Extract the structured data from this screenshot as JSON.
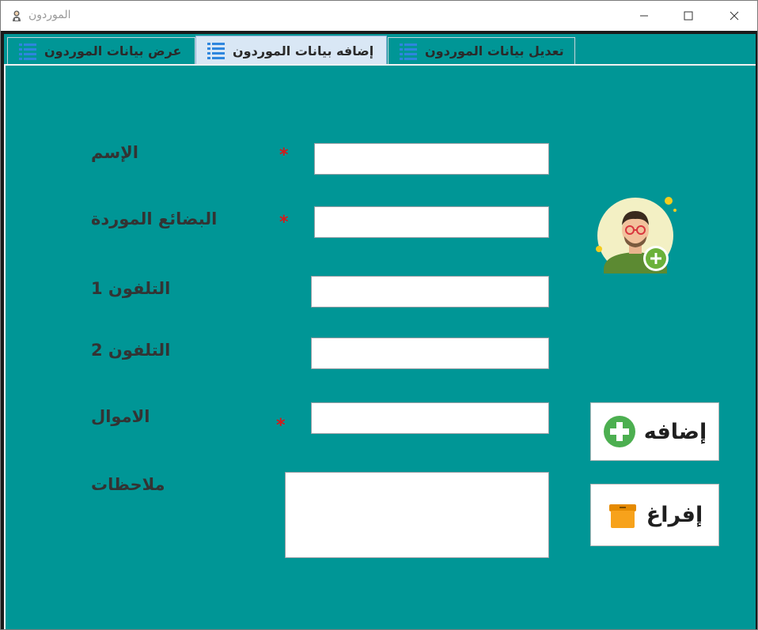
{
  "window": {
    "title": "الموردون",
    "app_icon": "person-icon"
  },
  "tabs": [
    {
      "label": "عرض بيانات الموردون",
      "icon": "list-icon",
      "active": false
    },
    {
      "label": "إضافه بيانات الموردون",
      "icon": "list-icon",
      "active": true
    },
    {
      "label": "تعديل بيانات الموردون",
      "icon": "list-icon",
      "active": false
    }
  ],
  "form": {
    "name_label": "الإسم",
    "goods_label": "البضائع الموردة",
    "phone1_label": "التلفون 1",
    "phone2_label": "التلفون 2",
    "money_label": "الاموال",
    "notes_label": "ملاحظات",
    "required_mark": "*",
    "name_value": "",
    "goods_value": "",
    "phone1_value": "",
    "phone2_value": "",
    "money_value": "",
    "notes_value": ""
  },
  "buttons": {
    "add_label": "إضافه",
    "add_icon": "plus-circle-icon",
    "clear_label": "إفراغ",
    "clear_icon": "box-icon"
  },
  "avatar_icon": "add-user-avatar-icon",
  "colors": {
    "panel_bg": "#009696",
    "active_tab_bg": "#d9e7f5",
    "required": "#d41a1a",
    "add_icon_green": "#4caf50",
    "clear_icon_orange": "#f7a21b"
  }
}
